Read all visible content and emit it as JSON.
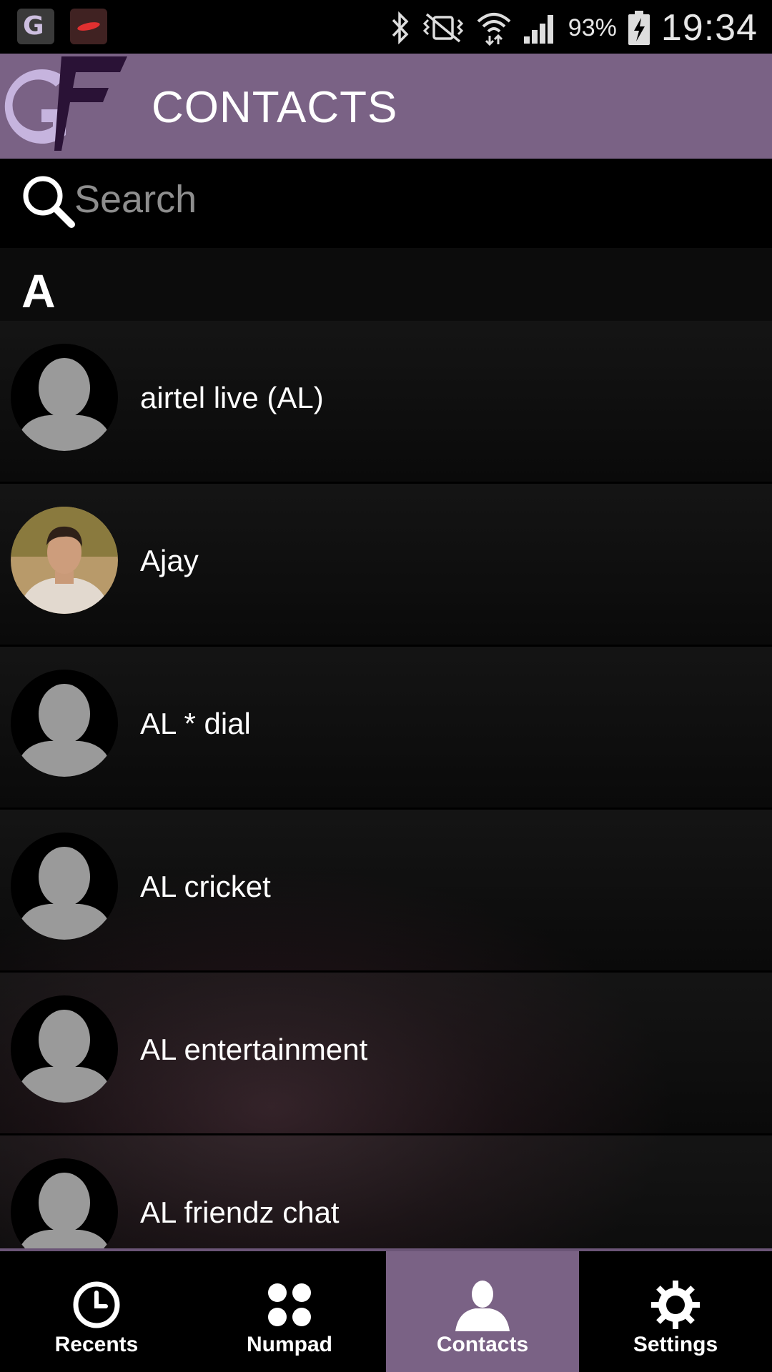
{
  "status_bar": {
    "battery_percent": "93%",
    "clock": "19:34",
    "notification_icons": [
      "g-app-icon",
      "bird-app-icon"
    ],
    "system_icons": [
      "bluetooth-icon",
      "vibrate-icon",
      "wifi-icon",
      "signal-icon",
      "battery-charging-icon"
    ]
  },
  "header": {
    "logo_icon": "gf-logo",
    "title": "CONTACTS"
  },
  "search": {
    "placeholder": "Search",
    "value": ""
  },
  "section": {
    "letter": "A"
  },
  "contacts": [
    {
      "name": "airtel live (AL)",
      "avatar": "placeholder"
    },
    {
      "name": "Ajay",
      "avatar": "photo"
    },
    {
      "name": "AL * dial",
      "avatar": "placeholder"
    },
    {
      "name": "AL cricket",
      "avatar": "placeholder"
    },
    {
      "name": "AL entertainment",
      "avatar": "placeholder"
    },
    {
      "name": "AL friendz chat",
      "avatar": "placeholder"
    }
  ],
  "bottom_nav": {
    "items": [
      {
        "label": "Recents",
        "icon": "clock-icon",
        "active": false
      },
      {
        "label": "Numpad",
        "icon": "numpad-icon",
        "active": false
      },
      {
        "label": "Contacts",
        "icon": "person-icon",
        "active": true
      },
      {
        "label": "Settings",
        "icon": "gear-icon",
        "active": false
      }
    ]
  },
  "colors": {
    "accent": "#7a6285",
    "background": "#000000"
  }
}
